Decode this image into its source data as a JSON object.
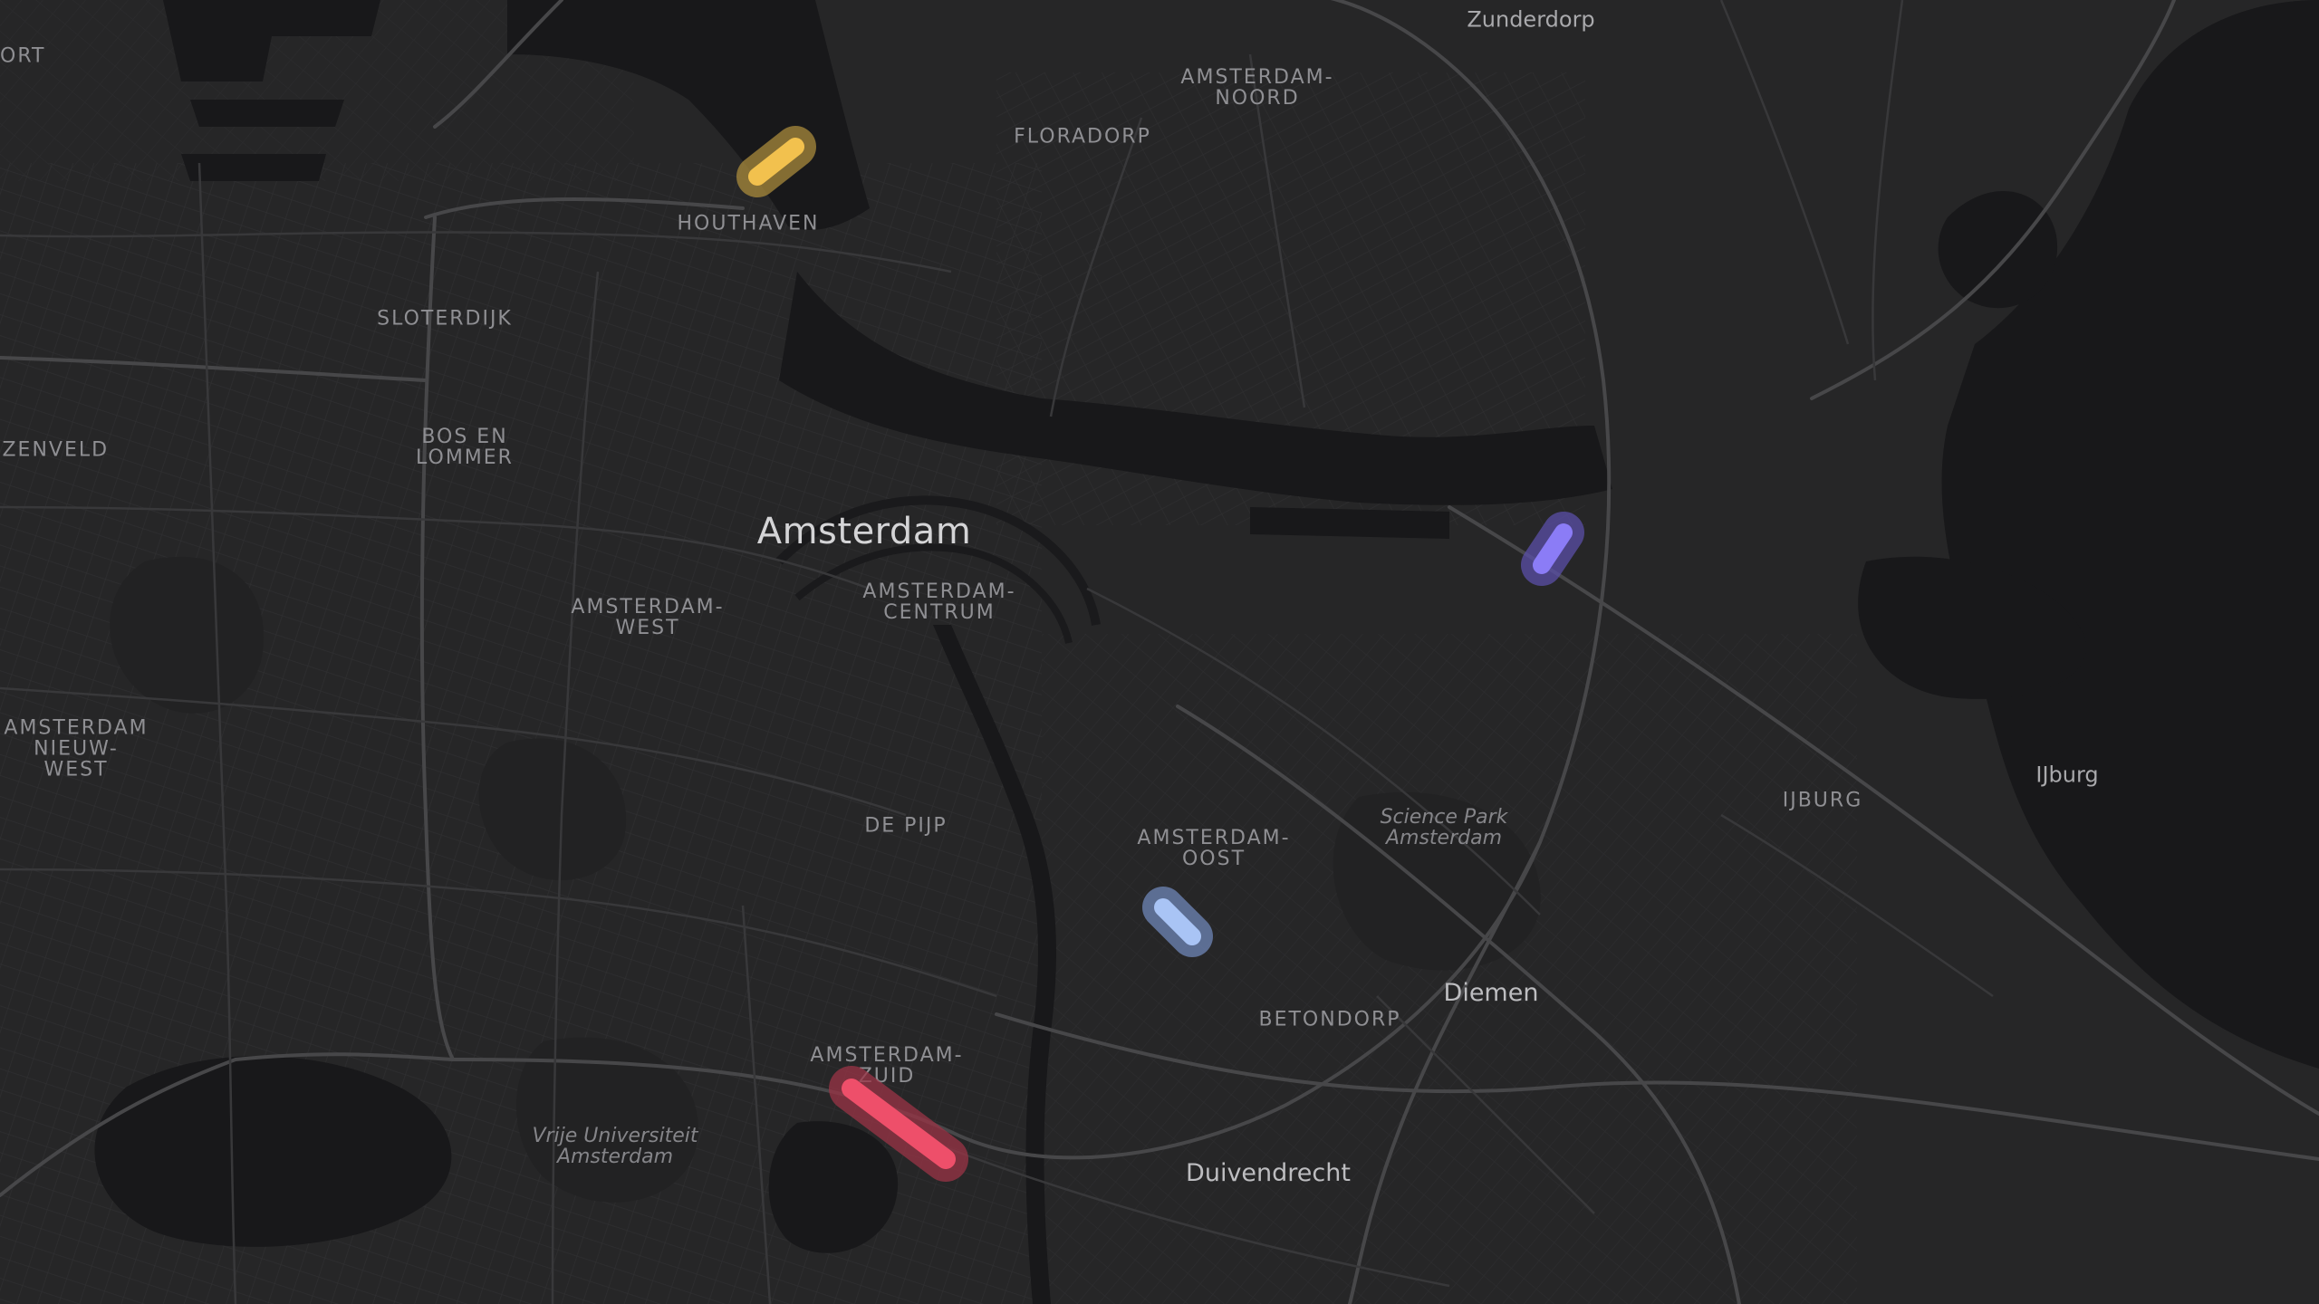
{
  "map": {
    "background_color": "#262627",
    "water_color": "#161617",
    "road_color": "#3a3a3c",
    "major_road_color": "#444447",
    "labels": {
      "zunderdorp": "Zunderdorp",
      "amsterdam_noord": "AMSTERDAM-\nNOORD",
      "floradorp": "FLORADORP",
      "houthaven": "HOUTHAVEN",
      "sloterdijk": "SLOTERDIJK",
      "bos_en_lommer": "BOS EN\nLOMMER",
      "amsterdam": "Amsterdam",
      "amsterdam_centrum": "AMSTERDAM-\nCENTRUM",
      "amsterdam_west": "AMSTERDAM-\nWEST",
      "amsterdam_nieuw_west": "AMSTERDAM\nNIEUW-\nWEST",
      "de_pijp": "DE PIJP",
      "amsterdam_oost": "AMSTERDAM-\nOOST",
      "science_park": "Science Park\nAmsterdam",
      "ijburg_district": "IJBURG",
      "ijburg": "IJburg",
      "diemen": "Diemen",
      "betondorp": "BETONDORP",
      "amsterdam_zuid": "AMSTERDAM-\nZUID",
      "vrije_universiteit": "Vrije Universiteit\nAmsterdam",
      "duivendrecht": "Duivendrecht",
      "edge_ort": "ORT",
      "edge_zenveld": "JZENVELD"
    },
    "markers": [
      {
        "name": "yellow-segment-marker",
        "color": "#f2c14e",
        "halo": "#a98a3c"
      },
      {
        "name": "purple-segment-marker",
        "color": "#8b7cf6",
        "halo": "#5a4fa8"
      },
      {
        "name": "lightblue-segment-marker",
        "color": "#a9c4f5",
        "halo": "#6f86b8"
      },
      {
        "name": "red-segment-marker",
        "color": "#ee4f6a",
        "halo": "#9a3446"
      }
    ]
  }
}
